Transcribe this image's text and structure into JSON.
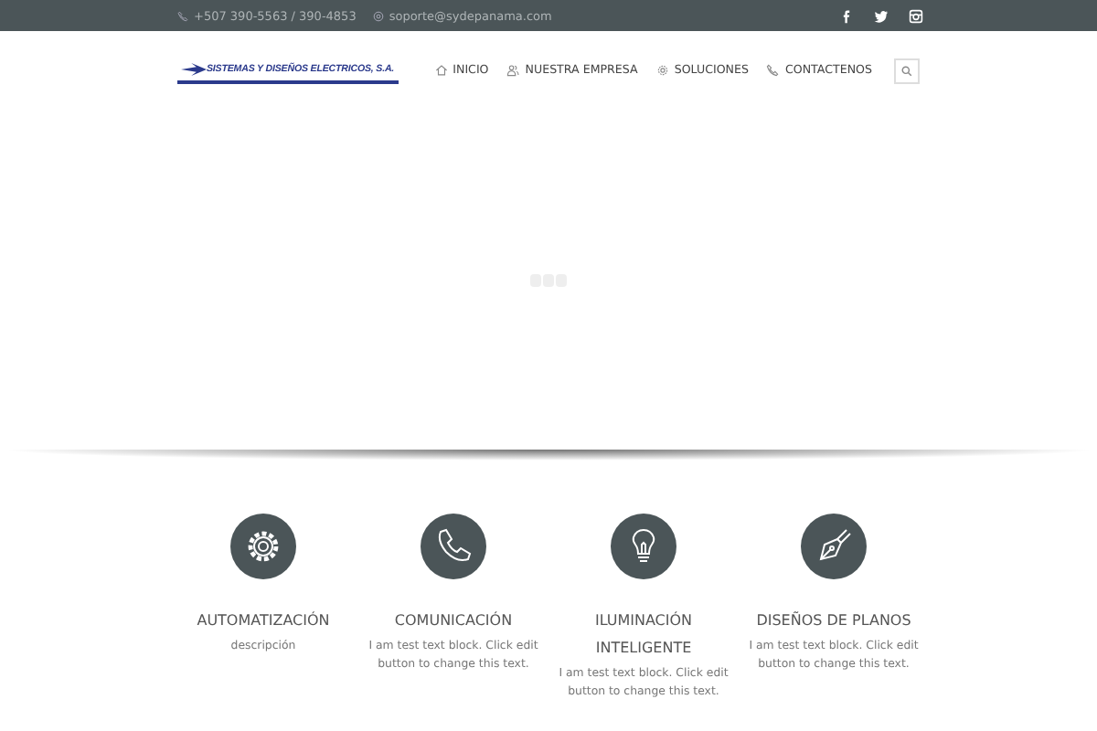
{
  "top_bar": {
    "phone": "+507 390-5563 / 390-4853",
    "email": "soporte@sydepanama.com"
  },
  "logo": {
    "text": "SISTEMAS Y DISEÑOS ELECTRICOS, S.A."
  },
  "nav": [
    {
      "label": "INICIO",
      "kind": "home"
    },
    {
      "label": "NUESTRA EMPRESA",
      "kind": "people"
    },
    {
      "label": "SOLUCIONES",
      "kind": "gear"
    },
    {
      "label": "CONTACTENOS",
      "kind": "phone"
    }
  ],
  "features": [
    {
      "kind": "gear",
      "title": "AUTOMATIZACIÓN",
      "text": "descripción"
    },
    {
      "kind": "phone",
      "title": "COMUNICACIÓN",
      "text": "I am test text block. Click edit button to change this text."
    },
    {
      "kind": "bulb",
      "title": "ILUMINACIÓN INTELIGENTE",
      "text": "I am test text block. Click edit button to change this text."
    },
    {
      "kind": "pen",
      "title": "DISEÑOS DE PLANOS",
      "text": "I am test text block. Click edit button to change this text."
    }
  ]
}
